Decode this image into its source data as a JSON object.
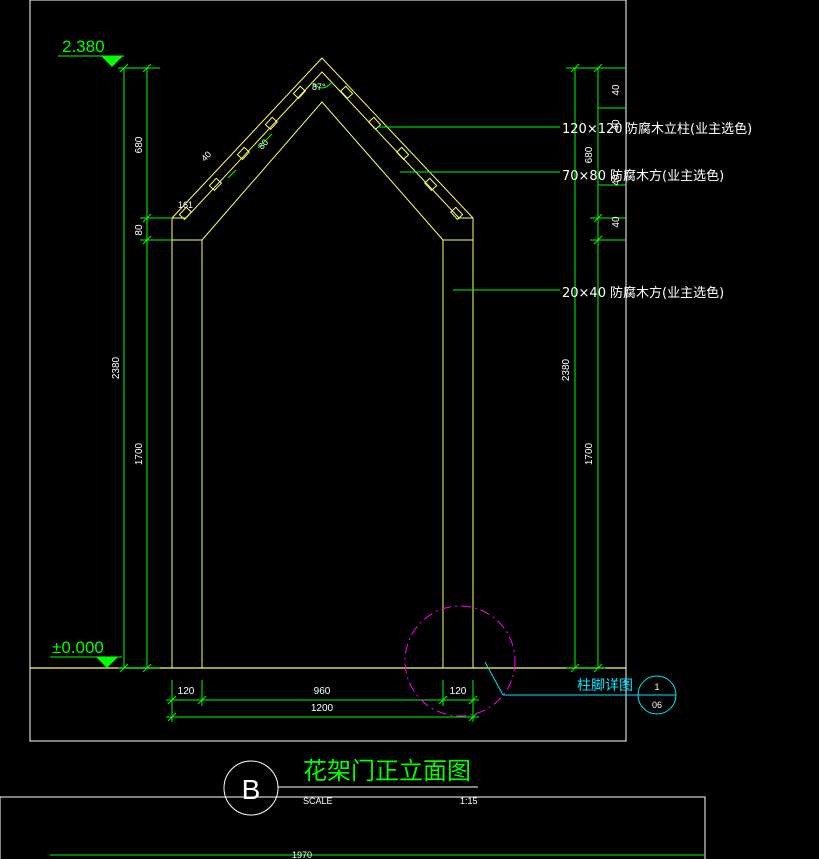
{
  "elevations": {
    "top": "2.380",
    "ground": "±0.000"
  },
  "dims_left": {
    "seg1": "680",
    "seg2": "80",
    "seg3": "1700",
    "total": "2380"
  },
  "dims_right": {
    "a": "40",
    "b": "40",
    "c": "40",
    "d": "40",
    "seg1": "680",
    "seg2": "1700",
    "total": "2380"
  },
  "dims_bottom": {
    "left": "120",
    "mid": "960",
    "right": "120",
    "total": "1200"
  },
  "angle_top": "87°",
  "roof_labels": {
    "a": "40",
    "b": "80",
    "c": "161"
  },
  "callouts": [
    {
      "size": "120×120",
      "text": "防腐木立柱(业主选色)"
    },
    {
      "size": "70×80",
      "text": "防腐木方(业主选色)"
    },
    {
      "size": "20×40",
      "text": "防腐木方(业主选色)"
    }
  ],
  "detail": {
    "label": "柱脚详图",
    "num": "1",
    "sheet": "06"
  },
  "title": {
    "letter": "B",
    "name": "花架门正立面图",
    "scale_label": "SCALE",
    "scale": "1:15"
  },
  "bottom_dim": "1970",
  "colors": {
    "line": "#ffff66",
    "dim": "#00ff00",
    "frame": "#ffffff",
    "leader": "#00ff00",
    "magenta": "#ff00ff",
    "cyan": "#00e5ff"
  }
}
